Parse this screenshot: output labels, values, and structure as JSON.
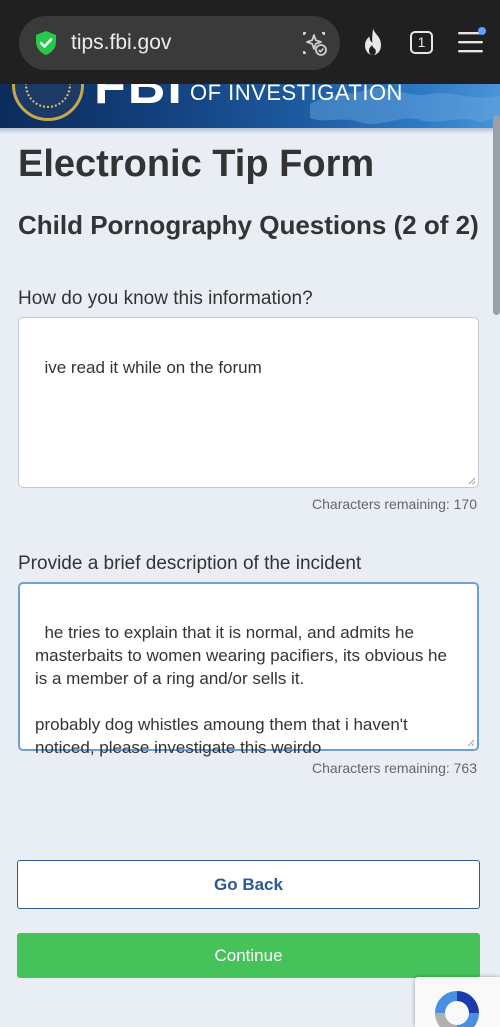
{
  "browser": {
    "url": "tips.fbi.gov",
    "tab_count": "1"
  },
  "banner": {
    "logo_text": "FBI",
    "subtitle": "OF INVESTIGATION"
  },
  "form": {
    "title": "Electronic Tip Form",
    "section": "Child Pornography Questions (2 of 2)",
    "q1": {
      "label": "How do you know this information?",
      "value": "ive read it while on the forum",
      "remaining": "Characters remaining: 170"
    },
    "q2": {
      "label": "Provide a brief description of the incident",
      "value": "he tries to explain that it is normal, and admits he masterbaits to women wearing pacifiers, its obvious he is a member of a ring and/or sells it.\n\nprobably dog whistles amoung them that i haven't noticed, please investigate this weirdo",
      "remaining": "Characters remaining: 763"
    },
    "back_label": "Go Back",
    "continue_label": "Continue"
  },
  "colors": {
    "continue": "#45c25a",
    "back_border": "#2c5a96",
    "browser_bar": "#202020"
  }
}
